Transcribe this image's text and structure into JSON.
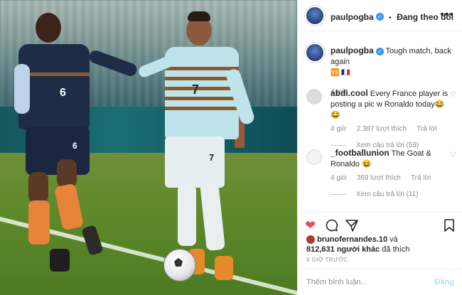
{
  "header": {
    "username": "paulpogba",
    "verified_icon": "verified-badge-icon",
    "separator": "•",
    "follow_label": "Đang theo dõi",
    "more_icon": "more-options-icon"
  },
  "caption": {
    "username": "paulpogba",
    "text": "Tough match, back again",
    "emoji": "🆚 🇫🇷",
    "time": "4 giờ"
  },
  "comments": [
    {
      "username": "abdi.cool",
      "text": "Every France player is posting a pic w Ronaldo today😂😂",
      "time": "4 giờ",
      "likes": "2.387 lượt thích",
      "reply_label": "Trả lời",
      "view_replies": "Xem câu trả lời (59)"
    },
    {
      "username": "_footballunion",
      "text": "The Goat & Ronaldo 😆",
      "time": "4 giờ",
      "likes": "369 lượt thích",
      "reply_label": "Trả lời",
      "view_replies": "Xem câu trả lời (11)"
    }
  ],
  "actions": {
    "like_icon": "heart-filled-icon",
    "comment_icon": "comment-icon",
    "share_icon": "share-icon",
    "save_icon": "bookmark-icon",
    "like_color": "#ed4956"
  },
  "likes": {
    "first_user": "brunofernandes.10",
    "joiner": "và",
    "count": "812,631 người khác",
    "suffix": "đã thích"
  },
  "posted_ago": "4 GIỜ TRƯỚC",
  "composer": {
    "placeholder": "Thêm bình luận...",
    "post_label": "Đăng"
  },
  "photo": {
    "shirt_numbers": [
      "6",
      "7",
      "7",
      "6"
    ]
  }
}
